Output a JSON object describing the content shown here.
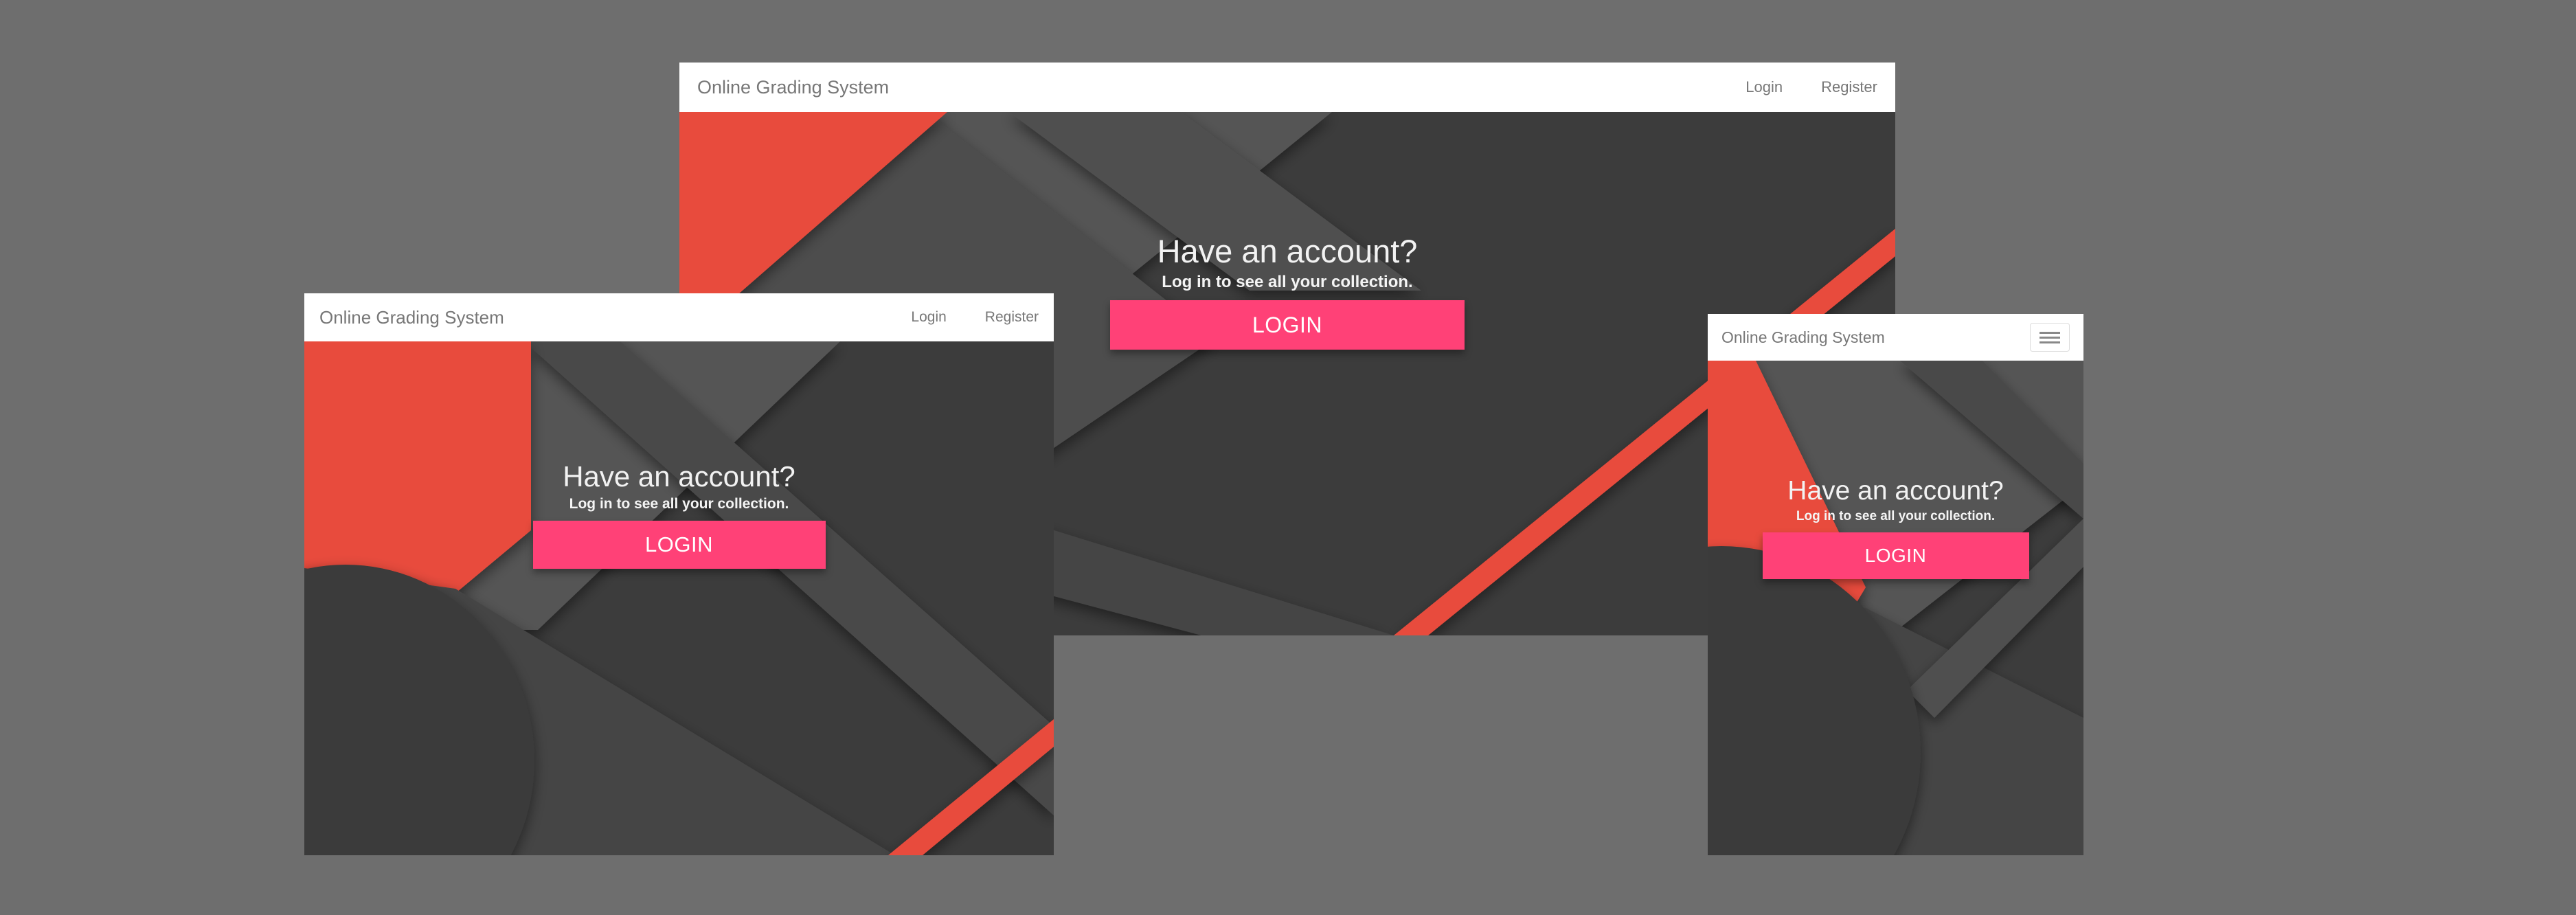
{
  "brand": "Online Grading System",
  "nav": {
    "login": "Login",
    "register": "Register"
  },
  "hero": {
    "title": "Have an account?",
    "subtitle": "Log in to see all your collection.",
    "button": "LOGIN"
  },
  "icons": {
    "menu": "hamburger-menu-icon"
  },
  "colors": {
    "page_background": "#6e6e6e",
    "navbar": "#ffffff",
    "hero_dark": "#3c3c3c",
    "hero_mid": "#555555",
    "accent_red": "#e84c3d",
    "button_pink": "#ff4177",
    "button_text": "#ffffff"
  },
  "views": [
    "desktop",
    "tablet",
    "mobile"
  ]
}
